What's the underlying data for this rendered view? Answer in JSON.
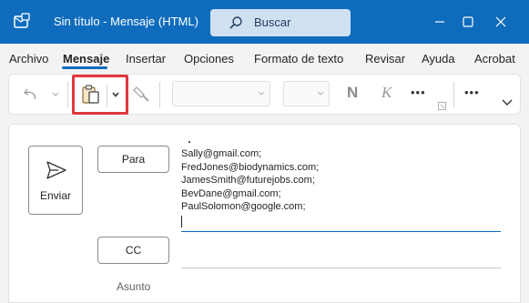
{
  "window": {
    "title": "Sin título  -  Mensaje (HTML)",
    "search_label": "Buscar"
  },
  "tabs": [
    {
      "label": "Archivo"
    },
    {
      "label": "Mensaje"
    },
    {
      "label": "Insertar"
    },
    {
      "label": "Opciones"
    },
    {
      "label": "Formato de texto"
    },
    {
      "label": "Revisar"
    },
    {
      "label": "Ayuda"
    },
    {
      "label": "Acrobat"
    }
  ],
  "active_tab": "Mensaje",
  "ribbon": {
    "bold_label": "N",
    "italic_label": "K",
    "more_label": "•••",
    "overflow_label": "•••"
  },
  "compose": {
    "send_label": "Enviar",
    "to_label": "Para",
    "cc_label": "CC",
    "subject_label": "Asunto",
    "recipients": [
      "Sally@gmail.com;",
      "FredJones@biodynamics.com;",
      "JamesSmith@futurejobs.com;",
      "BevDane@gmail.com;",
      "PaulSolomon@google.com;"
    ]
  },
  "colors": {
    "title_bar": "#0f6cbd",
    "highlight": "#e0383e",
    "accent": "#0f6cbd"
  }
}
